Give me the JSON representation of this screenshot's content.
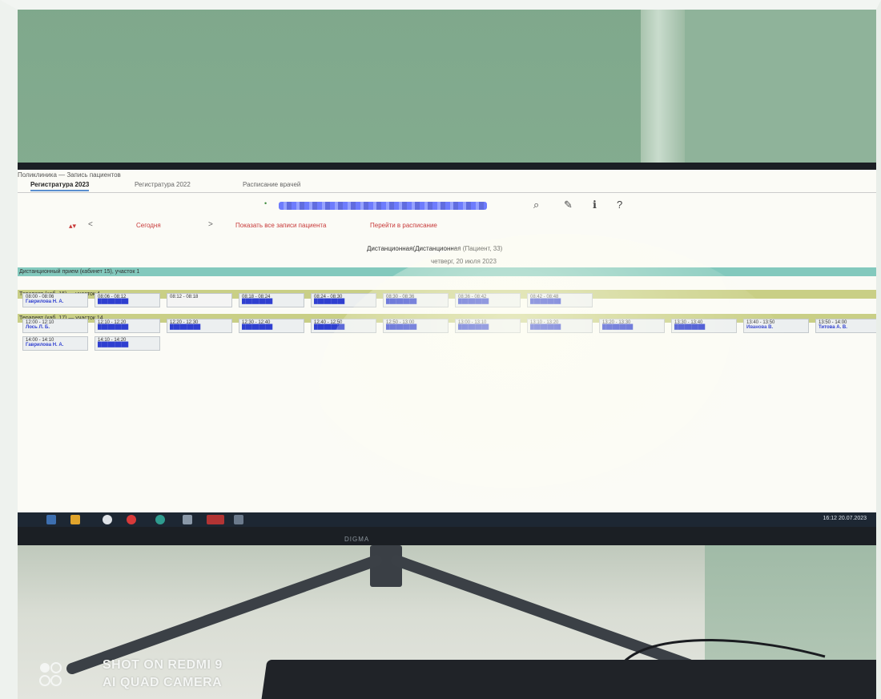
{
  "app": {
    "title": "Поликлиника — Запись пациентов"
  },
  "tabs": [
    {
      "label": "Регистратура 2023",
      "active": true
    },
    {
      "label": "Регистратура 2022",
      "active": false
    },
    {
      "label": "Расписание врачей",
      "active": false
    }
  ],
  "toolbar": {
    "name_prefix": "• ",
    "icons": [
      "search-icon",
      "edit-icon",
      "info-icon",
      "help-icon"
    ]
  },
  "nav": {
    "prev_label": "<",
    "today_label": "Сегодня",
    "next_label": ">",
    "link_1": "Показать все записи пациента",
    "link_2": "Перейти в расписание"
  },
  "schedule": {
    "department": "Дистанционная(Дистанционная (Пациент, 33)",
    "date": "четверг, 20 июля 2023",
    "section_teal": "Дистанционный прием (кабинет 15), участок 1",
    "section_olive_1": "Терапевт (каб. 15) — участок 4",
    "section_olive_2": "Терапевт (каб. 17) — участок 14",
    "row1": [
      {
        "time": "08:00 - 08:06",
        "patient": "Гаврилова Н. А."
      },
      {
        "time": "08:06 - 08:12",
        "patient": "█████████"
      },
      {
        "time": "08:12 - 08:18",
        "patient": ""
      },
      {
        "time": "08:18 - 08:24",
        "patient": "█████████"
      },
      {
        "time": "08:24 - 08:30",
        "patient": "█████████"
      },
      {
        "time": "08:30 - 08:36",
        "patient": "█████████"
      },
      {
        "time": "08:36 - 08:42",
        "patient": "█████████"
      },
      {
        "time": "08:42 - 08:48",
        "patient": "█████████"
      }
    ],
    "row2": [
      {
        "time": "12:00 - 12:10",
        "patient": "Лось Л. Б."
      },
      {
        "time": "12:10 - 12:20",
        "patient": "█████████"
      },
      {
        "time": "12:20 - 12:30",
        "patient": "█████████"
      },
      {
        "time": "12:30 - 12:40",
        "patient": "█████████"
      },
      {
        "time": "12:40 - 12:50",
        "patient": "█████████"
      },
      {
        "time": "12:50 - 13:00",
        "patient": "█████████"
      },
      {
        "time": "13:00 - 13:10",
        "patient": "█████████"
      },
      {
        "time": "13:10 - 13:20",
        "patient": "█████████"
      },
      {
        "time": "13:20 - 13:30",
        "patient": "█████████"
      },
      {
        "time": "13:30 - 13:40",
        "patient": "█████████"
      },
      {
        "time": "13:40 - 13:50",
        "patient": "Иванова В."
      },
      {
        "time": "13:50 - 14:00",
        "patient": "Титова А. В."
      }
    ],
    "row3": [
      {
        "time": "14:00 - 14:10",
        "patient": "Гаврилова Н. А."
      },
      {
        "time": "14:10 - 14:20",
        "patient": "█████████"
      }
    ]
  },
  "taskbar": {
    "clock": "16:12  20.07.2023"
  },
  "monitor": {
    "brand": "DIGMA"
  },
  "watermark": {
    "line1": "SHOT ON REDMI 9",
    "line2": "AI QUAD CAMERA"
  },
  "colors": {
    "teal_band": "#83c9bd",
    "olive_band": "#c9cf86",
    "nav_red": "#c83a3a",
    "tab_accent": "#5a8fcf"
  }
}
